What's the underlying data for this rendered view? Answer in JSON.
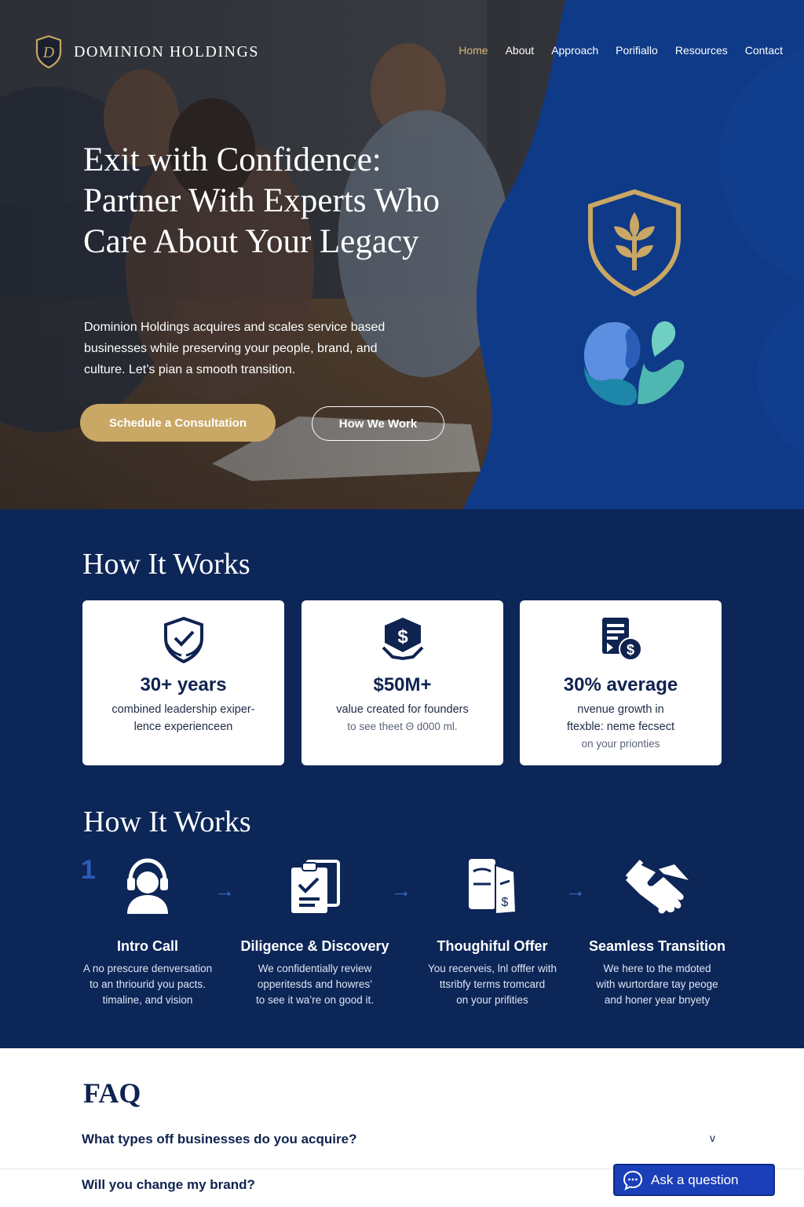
{
  "brand": {
    "name": "DOMINION HOLDINGS",
    "logo_icon": "shield-d-icon",
    "accent": "#c9a764"
  },
  "nav": {
    "items": [
      {
        "label": "Home",
        "active": true
      },
      {
        "label": "About",
        "active": false
      },
      {
        "label": "Approach",
        "active": false
      },
      {
        "label": "Porifiallo",
        "active": false
      },
      {
        "label": "Resources",
        "active": false
      },
      {
        "label": "Contact",
        "active": false
      }
    ]
  },
  "hero": {
    "title": "Exit with Confidence: Partner With Experts Who Care About Your Legacy",
    "subtitle": "Dominion Holdings acquires and scales service based businesses while preserving your people, brand, and culture. Let’s pian a smooth transition.",
    "primary_button": "Schedule a Consultation",
    "secondary_button": "How We Work",
    "badge_icons": [
      "shield-leaf-icon",
      "hands-heart-icon"
    ]
  },
  "stats": {
    "title": "How It Works",
    "cards": [
      {
        "icon": "shield-laurel-icon",
        "value": "30+ years",
        "line1": "combined leadership exiper-",
        "line2": "lence experienceen"
      },
      {
        "icon": "dollar-shield-icon",
        "value": "$50M+",
        "line1": "value created for founders",
        "line2": "to see theet Θ d000 ml."
      },
      {
        "icon": "report-dollar-icon",
        "value": "30% average",
        "line1": "nvenue growth in",
        "line2": "ftexble: neme fecsect",
        "line3": "on your prionties"
      }
    ]
  },
  "steps": {
    "title": "How It Works",
    "number": "1",
    "items": [
      {
        "icon": "person-headset-icon",
        "title": "Intro Call",
        "lines": [
          "A no prescure denversation",
          "to an thriourid you pacts.",
          "timaline, and vision"
        ]
      },
      {
        "icon": "clipboard-check-icon",
        "title": "Diligence & Discovery",
        "lines": [
          "We confidentially review",
          "opperitesds and howres’",
          "to see it wa’re on good it."
        ]
      },
      {
        "icon": "document-offer-icon",
        "title": "Thoughiful Offer",
        "lines": [
          "You recerveis, lnl offfer with",
          "ttsribfy terms tromcard",
          "on your prifities"
        ]
      },
      {
        "icon": "handshake-icon",
        "title": "Seamless Transition",
        "lines": [
          "We here to the mdoted",
          "with wurtordare tay peoge",
          "and honer year bnyety"
        ]
      }
    ]
  },
  "faq": {
    "title": "FAQ",
    "questions": [
      {
        "q": "What types off businesses do you acquire?",
        "expandable": true
      },
      {
        "q": "Will you change my brand?",
        "expandable": false
      }
    ]
  },
  "chat": {
    "label": "Ask a question",
    "icon": "chat-bubble-icon"
  }
}
